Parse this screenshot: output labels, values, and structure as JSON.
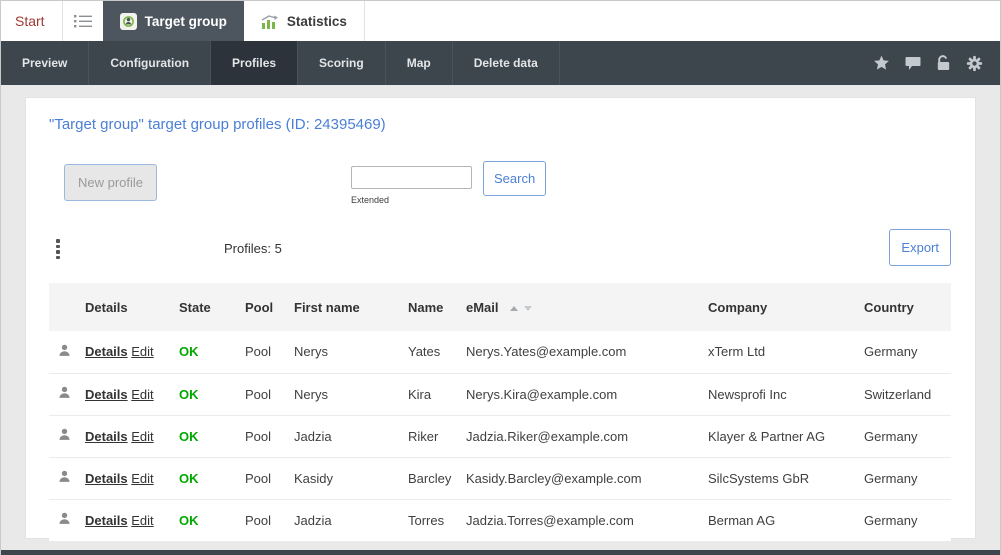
{
  "tab_bar": {
    "start_label": "Start",
    "target_group_tab": "Target group",
    "statistics_tab": "Statistics"
  },
  "toolbar": {
    "items": [
      "Preview",
      "Configuration",
      "Profiles",
      "Scoring",
      "Map",
      "Delete data"
    ],
    "active_item": "Profiles",
    "right_icons": [
      "star-icon",
      "comment-icon",
      "unlock-icon",
      "gear-icon"
    ]
  },
  "content": {
    "title": "\"Target group\" target group profiles (ID: 24395469)",
    "new_profile_button": "New profile",
    "search": {
      "value": "",
      "extended_label": "Extended",
      "button": "Search"
    },
    "profiles_count": "Profiles: 5",
    "export_button": "Export"
  },
  "table": {
    "headers": {
      "details": "Details",
      "state": "State",
      "pool": "Pool",
      "first_name": "First name",
      "name": "Name",
      "email": "eMail",
      "company": "Company",
      "country": "Country"
    },
    "rows": [
      {
        "details_link": "Details",
        "edit_link": "Edit",
        "state": "OK",
        "pool": "Pool",
        "first_name": "Nerys",
        "name": "Yates",
        "email": "Nerys.Yates@example.com",
        "company": "xTerm Ltd",
        "country": "Germany"
      },
      {
        "details_link": "Details",
        "edit_link": "Edit",
        "state": "OK",
        "pool": "Pool",
        "first_name": "Nerys",
        "name": "Kira",
        "email": "Nerys.Kira@example.com",
        "company": "Newsprofi Inc",
        "country": "Switzerland"
      },
      {
        "details_link": "Details",
        "edit_link": "Edit",
        "state": "OK",
        "pool": "Pool",
        "first_name": "Jadzia",
        "name": "Riker",
        "email": "Jadzia.Riker@example.com",
        "company": "Klayer & Partner AG",
        "country": "Germany"
      },
      {
        "details_link": "Details",
        "edit_link": "Edit",
        "state": "OK",
        "pool": "Pool",
        "first_name": "Kasidy",
        "name": "Barcley",
        "email": "Kasidy.Barcley@example.com",
        "company": "SilcSystems GbR",
        "country": "Germany"
      },
      {
        "details_link": "Details",
        "edit_link": "Edit",
        "state": "OK",
        "pool": "Pool",
        "first_name": "Jadzia",
        "name": "Torres",
        "email": "Jadzia.Torres@example.com",
        "company": "Berman AG",
        "country": "Germany"
      }
    ]
  },
  "colors": {
    "title_blue": "#4a7fd6",
    "button_border_blue": "#7ca3d9",
    "ok_green": "#00a900",
    "toolbar_bg": "#3d454d",
    "toolbar_active_bg": "#2c333a",
    "active_tab_bg": "#4d565e",
    "start_red": "#9c3b33",
    "header_bg": "#f4f4f4"
  }
}
